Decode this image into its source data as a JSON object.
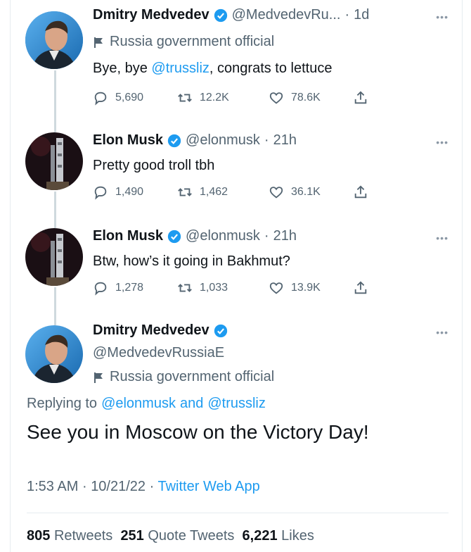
{
  "tweet1": {
    "name": "Dmitry Medvedev",
    "handle": "@MedvedevRu...",
    "dot": "·",
    "time": "1d",
    "label": "Russia government official",
    "text_pre": "Bye, bye ",
    "mention": "@trussliz",
    "text_post": ", congrats to lettuce",
    "replies": "5,690",
    "retweets": "12.2K",
    "likes": "78.6K"
  },
  "tweet2": {
    "name": "Elon Musk",
    "handle": "@elonmusk",
    "dot": "·",
    "time": "21h",
    "text": "Pretty good troll tbh",
    "replies": "1,490",
    "retweets": "1,462",
    "likes": "36.1K"
  },
  "tweet3": {
    "name": "Elon Musk",
    "handle": "@elonmusk",
    "dot": "·",
    "time": "21h",
    "text": "Btw, how’s it going in Bakhmut?",
    "replies": "1,278",
    "retweets": "1,033",
    "likes": "13.9K"
  },
  "tweet4": {
    "name": "Dmitry Medvedev",
    "handle": "@MedvedevRussiaE",
    "label": "Russia government official",
    "replying_to": "Replying to",
    "reply_user1": "@elonmusk",
    "reply_and": "and",
    "reply_user2": "@trussliz",
    "text": "See you in Moscow on the Victory Day!",
    "timestamp": "1:53 AM",
    "date": "10/21/22",
    "sep": "·",
    "source": "Twitter Web App",
    "retweets_count": "805",
    "retweets_label": "Retweets",
    "quotes_count": "251",
    "quotes_label": "Quote Tweets",
    "likes_count": "6,221",
    "likes_label": "Likes"
  },
  "more_label": "•••",
  "colors": {
    "accent": "#1d9bf0",
    "muted": "#536471",
    "line": "#cfd9de"
  },
  "icons": [
    "verified-icon",
    "flag-icon",
    "reply-icon",
    "retweet-icon",
    "like-icon",
    "share-icon",
    "more-icon"
  ]
}
